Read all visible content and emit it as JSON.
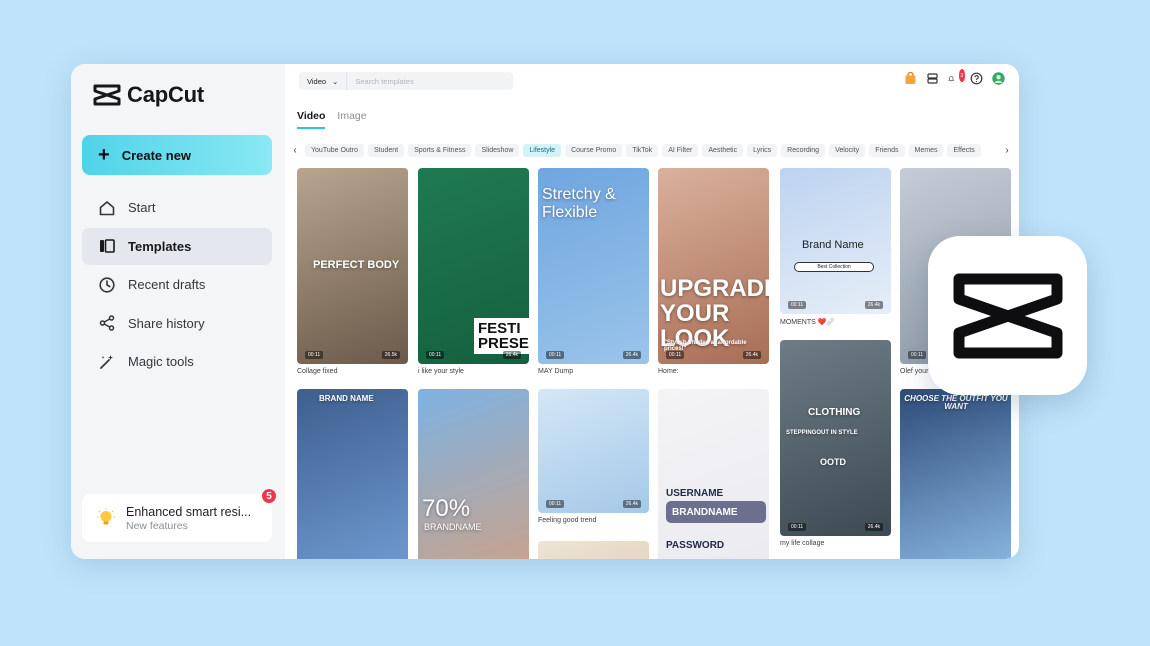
{
  "app": {
    "name": "CapCut"
  },
  "sidebar": {
    "create_label": "Create new",
    "items": [
      {
        "label": "Start",
        "icon": "home-icon"
      },
      {
        "label": "Templates",
        "icon": "templates-icon"
      },
      {
        "label": "Recent drafts",
        "icon": "clock-icon"
      },
      {
        "label": "Share history",
        "icon": "share-icon"
      },
      {
        "label": "Magic tools",
        "icon": "magic-wand-icon"
      }
    ],
    "promo": {
      "title": "Enhanced smart resi...",
      "subtitle": "New features",
      "badge": "5"
    }
  },
  "search": {
    "type": "Video",
    "placeholder": "Search templates"
  },
  "header": {
    "notifications": "3"
  },
  "tabs": [
    "Video",
    "Image"
  ],
  "chips": [
    "YouTube Outro",
    "Student",
    "Sports & Fitness",
    "Slideshow",
    "Lifestyle",
    "Course Promo",
    "TikTok",
    "AI Filter",
    "Aesthetic",
    "Lyrics",
    "Recording",
    "Velocity",
    "Friends",
    "Memes",
    "Effects"
  ],
  "active_chip": "Lifestyle",
  "cards": [
    {
      "caption": "Collage fixed",
      "duration": "00:11",
      "likes": "26.5k",
      "overlay": "PERFECT BODY",
      "colors": [
        "#b8a58f",
        "#6b5a4a"
      ]
    },
    {
      "caption": "i like your style",
      "duration": "00:11",
      "likes": "26.4k",
      "overlay": "FESTI PRESE",
      "colors": [
        "#1f7a52",
        "#15603f"
      ]
    },
    {
      "caption": "MAY Dump",
      "duration": "00:11",
      "likes": "26.4k",
      "overlay": "Stretchy & Flexible",
      "colors": [
        "#6fa6df",
        "#9ac4ea"
      ]
    },
    {
      "caption": "Home:",
      "duration": "00:11",
      "likes": "26.4k",
      "overlay": "UPGRADE YOUR LOOK",
      "subtext": "\"Stylish shades at affordable prices!\"",
      "colors": [
        "#d9b19b",
        "#a86d55"
      ]
    },
    {
      "caption": "MOMENTS ❤️🩹",
      "duration": "00:11",
      "likes": "26.4k",
      "overlay": "Brand Name",
      "pill": "Best Collection",
      "colors": [
        "#bcd3ef",
        "#e6eef8"
      ]
    },
    {
      "caption": "Olef your",
      "duration": "00:11",
      "likes": "26.4k",
      "overlay": "",
      "colors": [
        "#c5ccd6",
        "#8e98a6"
      ]
    },
    {
      "caption": "",
      "duration": "",
      "likes": "",
      "overlay": "BRAND NAME",
      "colors": [
        "#3e5f8f",
        "#6f9ad0"
      ]
    },
    {
      "caption": "",
      "duration": "",
      "likes": "",
      "overlay": "70%",
      "subtext": "BRANDNAME",
      "colors": [
        "#7db2e3",
        "#c9a28b"
      ]
    },
    {
      "caption": "Feeling good trend",
      "duration": "00:11",
      "likes": "26.4k",
      "overlay": "",
      "colors": [
        "#d3e7f6",
        "#a5c8e8"
      ]
    },
    {
      "caption": "",
      "duration": "",
      "likes": "",
      "overlay": "USERNAME",
      "field1": "BRANDNAME",
      "label2": "PASSWORD",
      "colors": [
        "#f4f4f6",
        "#eaeaf0"
      ]
    },
    {
      "caption": "my life collage",
      "duration": "00:11",
      "likes": "26.4k",
      "overlay": "CLOTHING",
      "subtext": "STEPPINGOUT IN STYLE",
      "label2": "OOTD",
      "colors": [
        "#6d7c86",
        "#3d4a52"
      ]
    },
    {
      "caption": "",
      "duration": "",
      "likes": "",
      "overlay": "CHOOSE THE OUTFIT YOU WANT",
      "colors": [
        "#2e4c78",
        "#8bb7e3"
      ]
    },
    {
      "caption": "",
      "duration": "",
      "likes": "",
      "overlay": "",
      "colors": [
        "#efe4d5",
        "#e3d3bd"
      ]
    }
  ]
}
